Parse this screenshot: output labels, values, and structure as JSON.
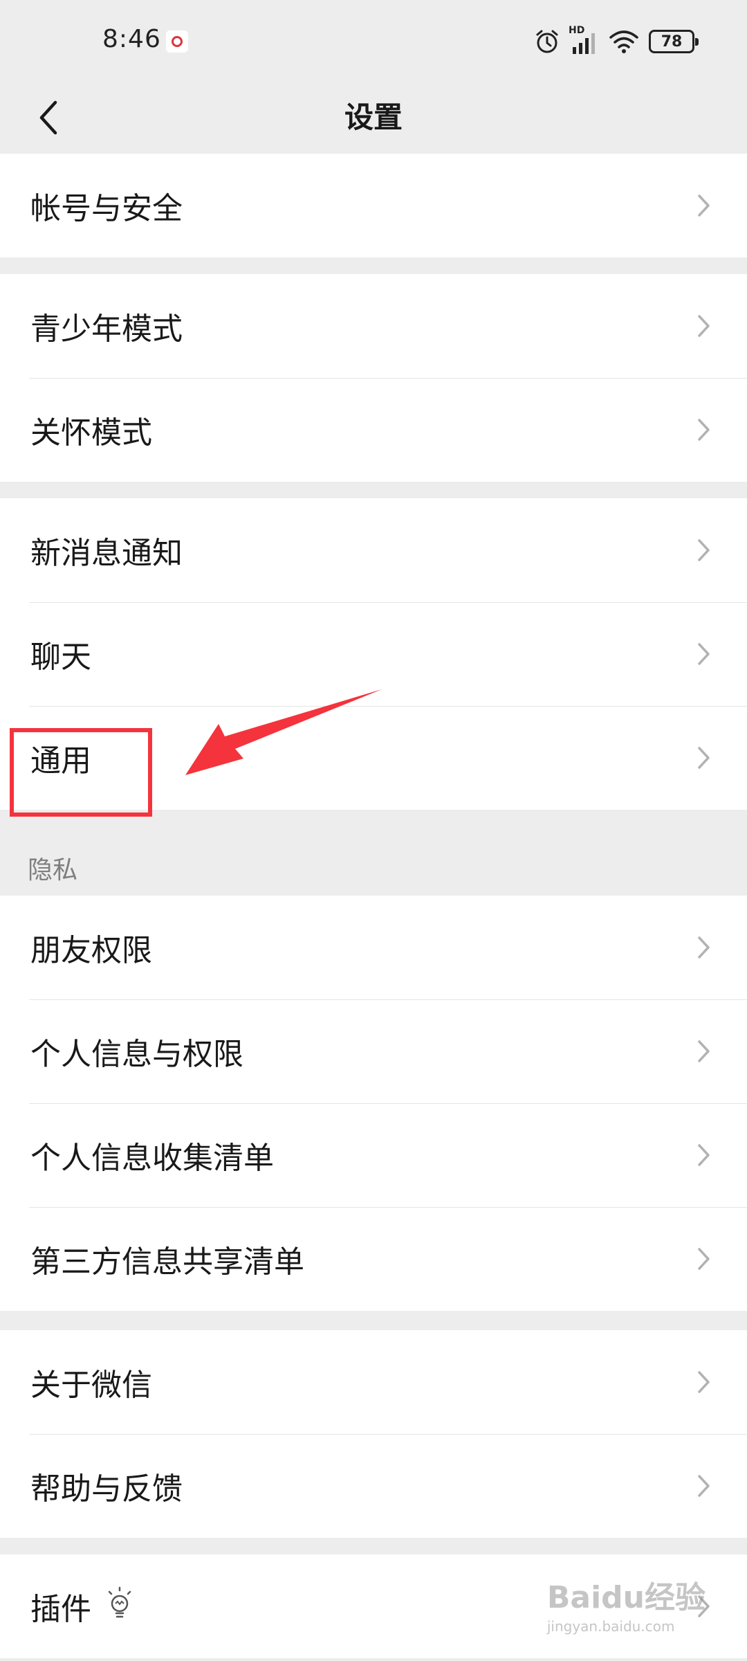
{
  "status_bar": {
    "time": "8:46",
    "battery": "78",
    "network_label": "HD",
    "icons": [
      "notification-icon",
      "alarm-icon",
      "signal-icon",
      "wifi-icon",
      "battery-icon"
    ]
  },
  "header": {
    "title": "设置",
    "back_icon": "chevron-left-icon"
  },
  "groups": [
    {
      "items": [
        {
          "label": "帐号与安全"
        }
      ]
    },
    {
      "items": [
        {
          "label": "青少年模式"
        },
        {
          "label": "关怀模式"
        }
      ]
    },
    {
      "items": [
        {
          "label": "新消息通知"
        },
        {
          "label": "聊天"
        },
        {
          "label": "通用"
        }
      ]
    },
    {
      "header": "隐私",
      "items": [
        {
          "label": "朋友权限"
        },
        {
          "label": "个人信息与权限"
        },
        {
          "label": "个人信息收集清单"
        },
        {
          "label": "第三方信息共享清单"
        }
      ]
    },
    {
      "items": [
        {
          "label": "关于微信"
        },
        {
          "label": "帮助与反馈"
        }
      ]
    },
    {
      "items": [
        {
          "label": "插件",
          "icon": "lightbulb-icon"
        }
      ]
    }
  ],
  "annotation": {
    "target": "通用",
    "highlight_color": "#f4333c",
    "arrow_color": "#f4333c"
  },
  "watermark": {
    "brand": "Baidu经验",
    "url": "jingyan.baidu.com"
  },
  "colors": {
    "background": "#ededed",
    "row_background": "#ffffff",
    "text": "#191919",
    "secondary_text": "#7f7f7f",
    "chevron": "#b2b2b2"
  }
}
